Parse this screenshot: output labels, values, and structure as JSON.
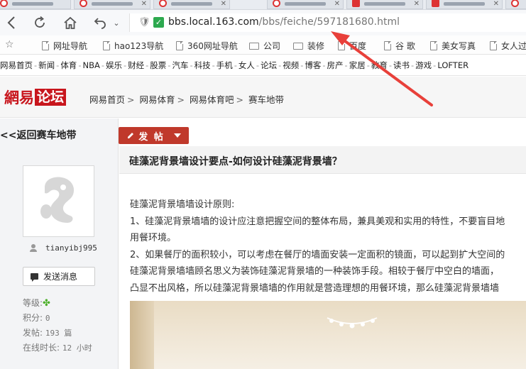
{
  "browser": {
    "url_host": "bbs.local.163.com",
    "url_path": "/bbs/feiche/597181680.html"
  },
  "bookmarks": [
    {
      "label": "网址导航",
      "icon": "doc-icon"
    },
    {
      "label": "hao123导航",
      "icon": "doc-icon"
    },
    {
      "label": "360网址导航",
      "icon": "doc-icon"
    },
    {
      "label": "公司",
      "icon": "folder-icon"
    },
    {
      "label": "装修",
      "icon": "folder-icon"
    },
    {
      "label": "百度",
      "icon": "doc-icon"
    },
    {
      "label": "谷 歌",
      "icon": "doc-icon"
    },
    {
      "label": "美女写真",
      "icon": "doc-icon"
    },
    {
      "label": "女人过",
      "icon": "doc-icon"
    }
  ],
  "topnav": [
    "网易首页",
    "新闻",
    "体育",
    "NBA",
    "娱乐",
    "财经",
    "股票",
    "汽车",
    "科技",
    "手机",
    "女人",
    "论坛",
    "视频",
    "博客",
    "房产",
    "家居",
    "教育",
    "读书",
    "游戏",
    "LOFTER"
  ],
  "header": {
    "logo_a": "網易",
    "logo_b": "论坛",
    "breadcrumb": [
      "网易首页",
      "网易体育",
      "网易体育吧",
      "赛车地带"
    ]
  },
  "sidebar": {
    "back_label": "<<返回赛车地带",
    "username": "tianyibj995",
    "message_button": "发送消息",
    "stats": {
      "level_label": "等级:",
      "points_label": "积分:",
      "points_value": "0",
      "posts_label": "发帖:",
      "posts_value": "193 篇",
      "online_label": "在线时长:",
      "online_value": "12 小时"
    }
  },
  "post": {
    "new_post_label": "发 帖",
    "title": "硅藻泥背景墙设计要点-如何设计硅藻泥背景墙？",
    "lines": [
      "硅藻泥背景墙墙设计原则:",
      "1、硅藻泥背景墙墙的设计应注意把握空间的整体布局，兼具美观和实用的特性，不要盲目地",
      "用餐环境。",
      "2、如果餐厅的面积较小，可以考虑在餐厅的墙面安装一定面积的镜面，可以起到扩大空间的",
      "硅藻泥背景墙墙顾名思义为装饰硅藻泥背景墙的一种装饰手段。相较于餐厅中空白的墙面，",
      "凸显不出风格，所以硅藻泥背景墙墙的作用就是营造理想的用餐环境，那么硅藻泥背景墙墙"
    ]
  },
  "colors": {
    "brand_red": "#c8161d",
    "post_button": "#c0392b",
    "secure_green": "#2da94f",
    "annotation_arrow": "#e8403a"
  }
}
